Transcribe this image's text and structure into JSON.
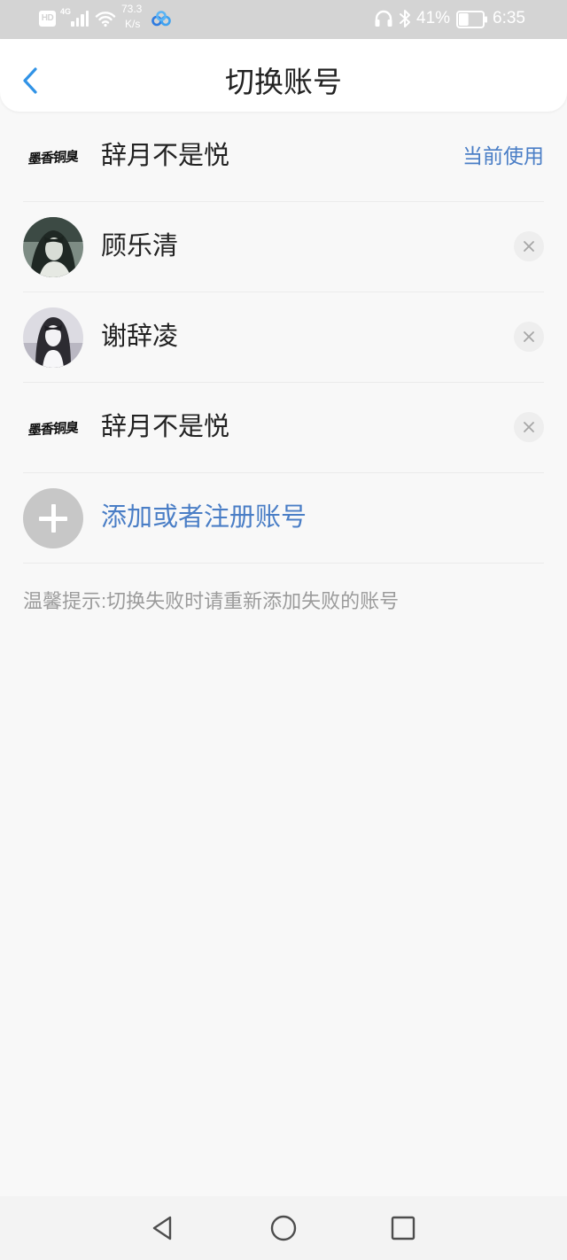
{
  "status_bar": {
    "hd_label": "HD",
    "network_type": "4G",
    "signal_level": 4,
    "net_speed_value": "73.3",
    "net_speed_unit": "K/s",
    "battery_text": "41%",
    "battery_level": 0.41,
    "time": "6:35",
    "icons": [
      "hd-icon",
      "cellular-signal-icon",
      "wifi-icon",
      "cloud-sync-icon",
      "headphones-icon",
      "bluetooth-icon",
      "battery-icon"
    ]
  },
  "header": {
    "back_icon": "chevron-left-icon",
    "title": "切换账号"
  },
  "accounts": [
    {
      "name": "辞月不是悦",
      "avatar_signature": "墨香铜臭",
      "current": true,
      "current_label": "当前使用"
    },
    {
      "name": "顾乐清",
      "current": false,
      "remove_icon": "close-icon"
    },
    {
      "name": "谢辞凌",
      "current": false,
      "remove_icon": "close-icon"
    },
    {
      "name": "辞月不是悦",
      "avatar_signature": "墨香铜臭",
      "current": false,
      "remove_icon": "close-icon"
    }
  ],
  "add_account": {
    "icon": "plus-icon",
    "label": "添加或者注册账号"
  },
  "tip": "温馨提示:切换失败时请重新添加失败的账号",
  "nav_bar": {
    "icons": [
      "back-triangle-icon",
      "home-circle-icon",
      "recents-square-icon"
    ]
  },
  "colors": {
    "status_bar_bg": "#d4d4d4",
    "accent": "#4a7ec6",
    "back_icon": "#3193e6",
    "text_primary": "#222222",
    "text_hint": "#9b9b9b",
    "add_circle": "#c7c7c7",
    "close_button_bg": "#eeeeee",
    "page_bg": "#f8f8f8",
    "nav_bar_bg": "#f3f3f3"
  }
}
